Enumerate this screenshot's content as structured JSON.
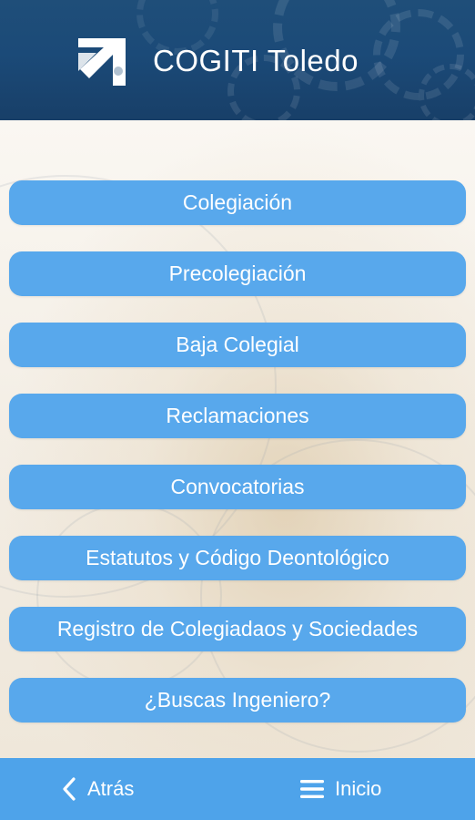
{
  "header": {
    "title": "COGITI Toledo",
    "logo_icon": "cogiti-logo-icon"
  },
  "menu": {
    "items": [
      {
        "label": "Colegiación"
      },
      {
        "label": "Precolegiación"
      },
      {
        "label": "Baja Colegial"
      },
      {
        "label": "Reclamaciones"
      },
      {
        "label": "Convocatorias"
      },
      {
        "label": "Estatutos y Código Deontológico"
      },
      {
        "label": "Registro de Colegiadaos y Sociedades"
      },
      {
        "label": "¿Buscas Ingeniero?"
      }
    ]
  },
  "bottom_nav": {
    "back_label": "Atrás",
    "back_icon": "chevron-left-icon",
    "home_label": "Inicio",
    "home_icon": "hamburger-menu-icon"
  },
  "colors": {
    "header_bg": "#1f4e79",
    "button_bg": "#58a8ec",
    "nav_bg": "#4ea3ea",
    "text": "#ffffff"
  }
}
